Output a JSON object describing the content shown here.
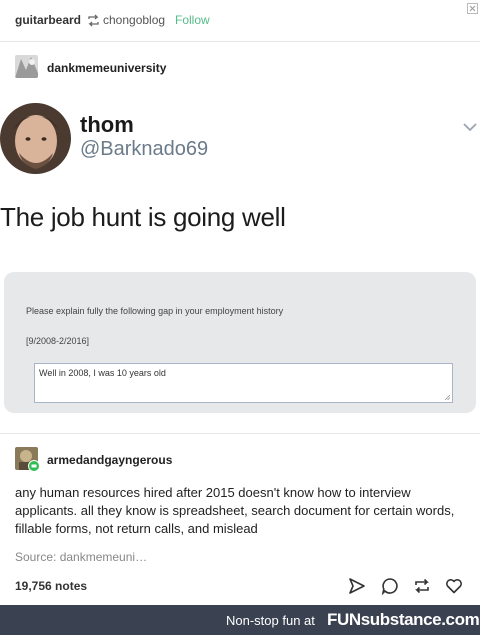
{
  "post": {
    "reblogger": "guitarbeard",
    "source_blog": "chongoblog",
    "follow_label": "Follow"
  },
  "original": {
    "username": "dankmemeuniversity"
  },
  "tweet": {
    "display_name": "thom",
    "handle": "@Barknado69",
    "text": "The job hunt is going well"
  },
  "form": {
    "question": "Please explain fully the following gap in your employment history",
    "dates": "[9/2008-2/2016]",
    "answer": "Well in 2008, I was 10 years old"
  },
  "reply": {
    "username": "armedandgayngerous",
    "comment": "any human resources hired after 2015 doesn't know how to interview applicants. all they know is spreadsheet, search document for certain words, fillable forms, not return calls, and mislead"
  },
  "meta": {
    "source": "Source: dankmemeuni…",
    "notes": "19,756 notes"
  },
  "actions": [
    "send-icon",
    "reply-icon",
    "reblog-icon",
    "like-icon"
  ],
  "footer": {
    "tagline": "Non-stop fun at",
    "brand": "FUNsubstance.com"
  },
  "colors": {
    "follow": "#56bc8a",
    "footer_bg": "#3a4150",
    "handle": "#6b7b8a"
  }
}
